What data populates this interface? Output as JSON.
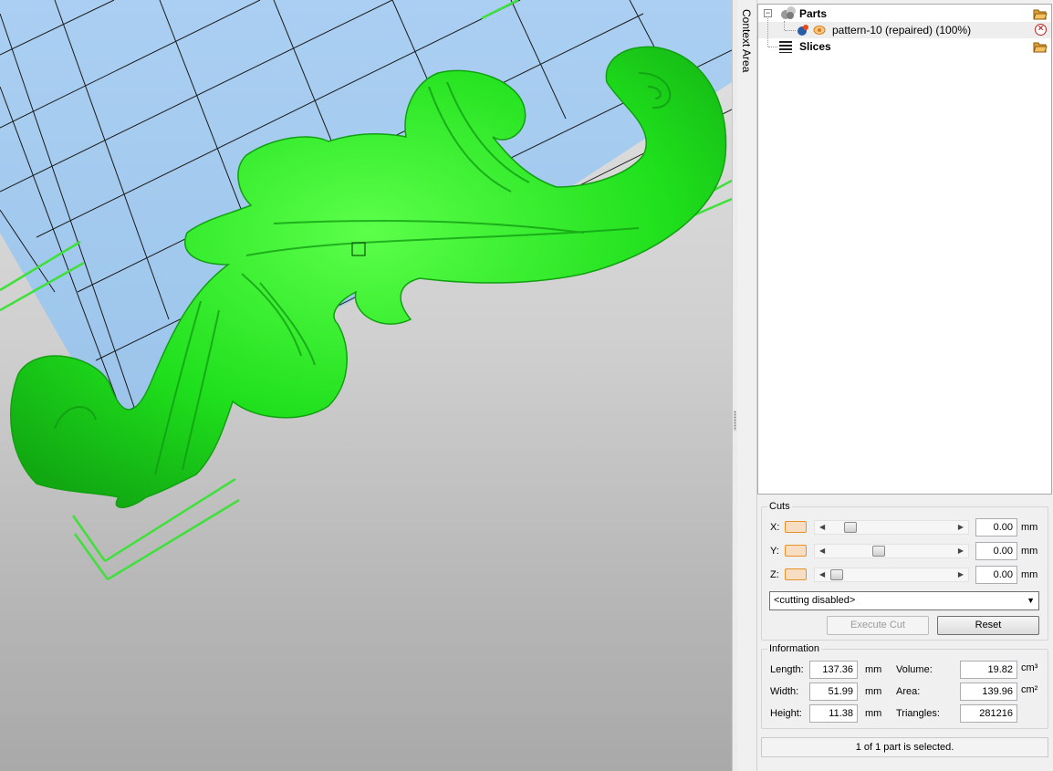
{
  "context_tab": {
    "label": "Context Area"
  },
  "tree": {
    "parts": {
      "label": "Parts"
    },
    "part_item": {
      "label": "pattern-10 (repaired) (100%)"
    },
    "slices": {
      "label": "Slices"
    }
  },
  "cuts": {
    "title": "Cuts",
    "rows": [
      {
        "axis": "X:",
        "value": "0.00",
        "unit": "mm",
        "position": 0.22
      },
      {
        "axis": "Y:",
        "value": "0.00",
        "unit": "mm",
        "position": 0.42
      },
      {
        "axis": "Z:",
        "value": "0.00",
        "unit": "mm",
        "position": 0.11
      }
    ],
    "mode": "<cutting disabled>",
    "execute_label": "Execute Cut",
    "reset_label": "Reset"
  },
  "information": {
    "title": "Information",
    "length_label": "Length:",
    "length_value": "137.36",
    "width_label": "Width:",
    "width_value": "51.99",
    "height_label": "Height:",
    "height_value": "11.38",
    "mm": "mm",
    "volume_label": "Volume:",
    "volume_value": "19.82",
    "volume_unit": "cm³",
    "area_label": "Area:",
    "area_value": "139.96",
    "area_unit": "cm²",
    "triangles_label": "Triangles:",
    "triangles_value": "281216"
  },
  "status": {
    "text": "1 of 1 part is selected."
  },
  "colors": {
    "model": "#22e022",
    "platform": "#a8cdf0",
    "grid_line": "#1a1a1a",
    "accent_orange": "#e8902a"
  }
}
